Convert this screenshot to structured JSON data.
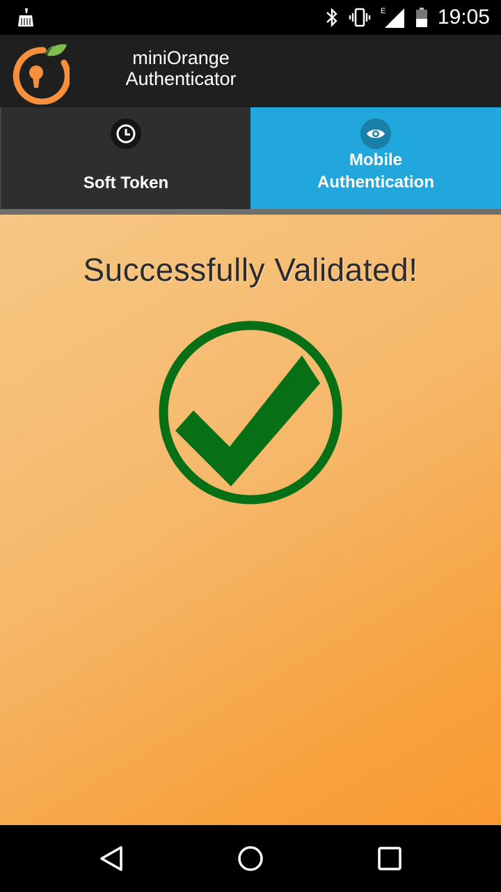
{
  "status_bar": {
    "time": "19:05",
    "network_type": "E",
    "icons": [
      "cleaner-icon",
      "bluetooth-icon",
      "vibrate-icon",
      "signal-icon",
      "battery-icon"
    ]
  },
  "app_bar": {
    "title_line1": "miniOrange",
    "title_line2": "Authenticator",
    "logo_icon": "miniorange-logo-icon"
  },
  "tabs": [
    {
      "label": "Soft Token",
      "icon": "clock-icon",
      "selected": false
    },
    {
      "label_line1": "Mobile",
      "label_line2": "Authentication",
      "icon": "eye-icon",
      "selected": true
    }
  ],
  "content": {
    "message": "Successfully Validated!",
    "status_icon": "success-check-icon"
  },
  "nav_bar": {
    "buttons": [
      "back-icon",
      "home-icon",
      "recent-apps-icon"
    ]
  },
  "colors": {
    "app_bar": "#1f1f1f",
    "tab_inactive": "#2e2e2e",
    "tab_active": "#22a7dd",
    "check_green": "#076f16",
    "brand_orange": "#f7903d",
    "leaf_green": "#7fbf4d"
  }
}
